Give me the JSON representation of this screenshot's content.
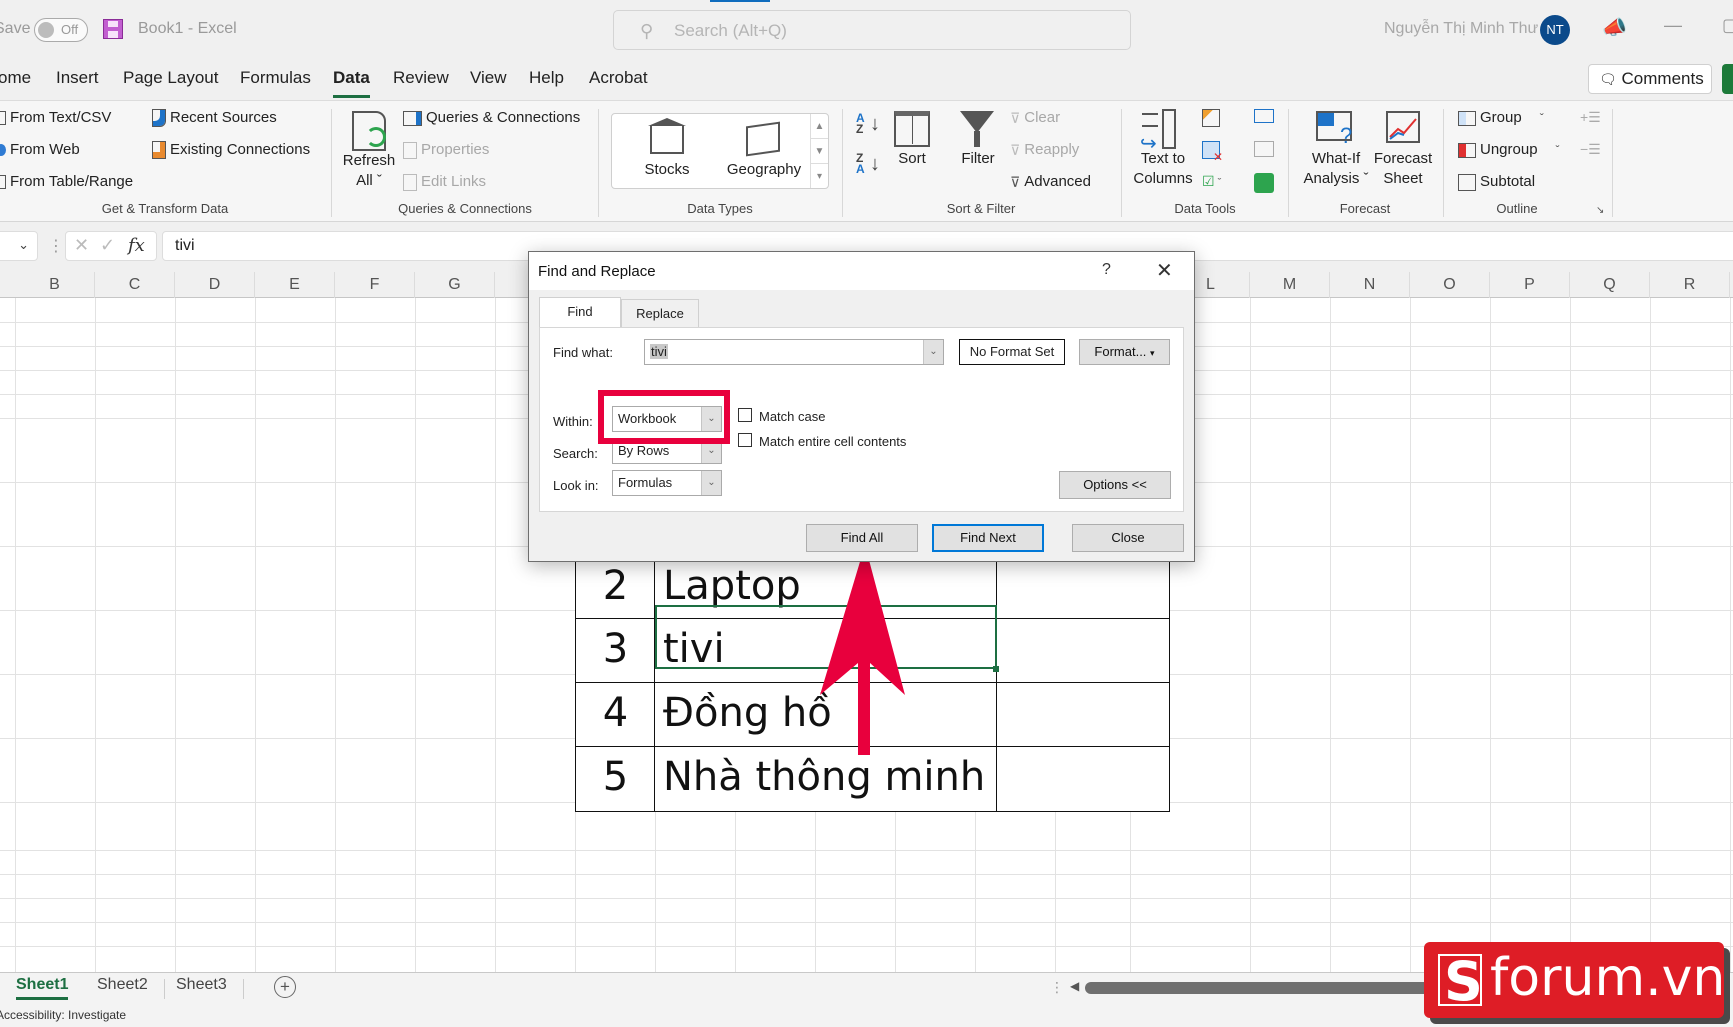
{
  "titlebar": {
    "autosave_label": "Save",
    "autosave_state": "Off",
    "doc_title": "Book1  -  Excel",
    "search_placeholder": "Search (Alt+Q)",
    "user_name": "Nguyễn Thị Minh Thư",
    "user_initials": "NT",
    "minimize": "—",
    "restore": "▢"
  },
  "menu": {
    "tabs": [
      "ome",
      "Insert",
      "Page Layout",
      "Formulas",
      "Data",
      "Review",
      "View",
      "Help",
      "Acrobat"
    ],
    "active": "Data",
    "comments_label": "Comments"
  },
  "ribbon": {
    "get_transform": {
      "items": [
        "From Text/CSV",
        "From Web",
        "From Table/Range",
        "Recent Sources",
        "Existing Connections"
      ],
      "label": "Get & Transform Data"
    },
    "queries": {
      "refresh_line1": "Refresh",
      "refresh_line2": "All ˇ",
      "items": [
        "Queries & Connections",
        "Properties",
        "Edit Links"
      ],
      "label": "Queries & Connections"
    },
    "data_types": {
      "items": [
        "Stocks",
        "Geography"
      ],
      "label": "Data Types"
    },
    "sort_filter": {
      "sort": "Sort",
      "filter": "Filter",
      "clear": "Clear",
      "reapply": "Reapply",
      "advanced": "Advanced",
      "label": "Sort & Filter"
    },
    "data_tools": {
      "text_to_columns_line1": "Text to",
      "text_to_columns_line2": "Columns",
      "label": "Data Tools"
    },
    "forecast": {
      "whatif_line1": "What-If",
      "whatif_line2": "Analysis ˇ",
      "forecast_line1": "Forecast",
      "forecast_line2": "Sheet",
      "label": "Forecast"
    },
    "outline": {
      "items": [
        "Group",
        "Ungroup",
        "Subtotal"
      ],
      "label": "Outline"
    }
  },
  "formula_bar": {
    "value": "tivi",
    "fx": "fx"
  },
  "grid": {
    "columns_left": [
      "B",
      "C",
      "D",
      "E",
      "F",
      "G"
    ],
    "columns_right": [
      "L",
      "M",
      "N",
      "O",
      "P",
      "Q",
      "R"
    ]
  },
  "table": {
    "rows": [
      {
        "num": "2",
        "name": "Laptop"
      },
      {
        "num": "3",
        "name": "tivi"
      },
      {
        "num": "4",
        "name": "Đồng hồ"
      },
      {
        "num": "5",
        "name": "Nhà thông minh"
      }
    ]
  },
  "dialog": {
    "title": "Find and Replace",
    "help": "?",
    "close": "✕",
    "tabs": {
      "find": "Find",
      "replace": "Replace"
    },
    "find_what_label": "Find what:",
    "find_what_value": "tivi",
    "no_format": "No Format Set",
    "format_btn": "Format...",
    "within_label": "Within:",
    "within_value": "Workbook",
    "search_label": "Search:",
    "search_value": "By Rows",
    "lookin_label": "Look in:",
    "lookin_value": "Formulas",
    "match_case": "Match case",
    "match_entire": "Match entire cell contents",
    "options_btn": "Options <<",
    "find_all": "Find All",
    "find_next": "Find Next",
    "close_btn": "Close"
  },
  "sheets": {
    "tabs": [
      "Sheet1",
      "Sheet2",
      "Sheet3"
    ],
    "active": "Sheet1",
    "add": "+"
  },
  "status": {
    "text": "Accessibility: Investigate"
  },
  "watermark": {
    "text": "forum.vn",
    "color": "#de1d26"
  },
  "colors": {
    "excel_green": "#1d6f42",
    "annotation_red": "#e8003d",
    "dialog_default_blue": "#0078d7"
  }
}
